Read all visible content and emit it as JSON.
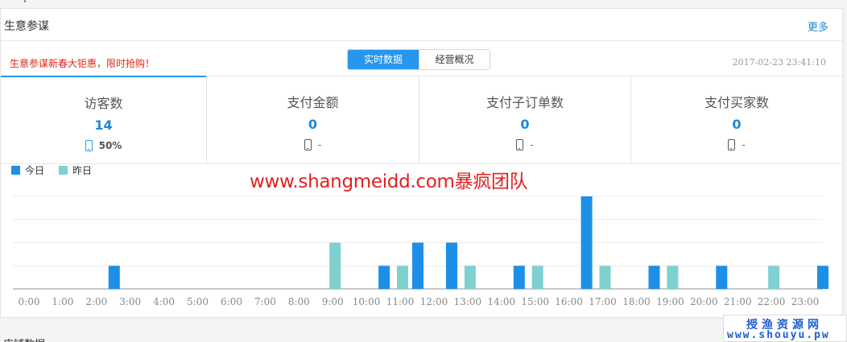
{
  "top_strip": {
    "text": "——/"
  },
  "panel": {
    "title": "生意参谋",
    "more": "更多"
  },
  "promo": "生意参谋新春大钜惠，限时抢购！",
  "tabs": [
    {
      "label": "实时数据",
      "active": true
    },
    {
      "label": "经营概况",
      "active": false
    }
  ],
  "timestamp": "2017-02-23 23:41:10",
  "metrics": [
    {
      "label": "访客数",
      "value": "14",
      "sub": "50%",
      "icon": "mobile-phone-icon",
      "active": true
    },
    {
      "label": "支付金额",
      "value": "0",
      "sub": "-",
      "icon": "mobile-phone-icon",
      "active": false
    },
    {
      "label": "支付子订单数",
      "value": "0",
      "sub": "-",
      "icon": "mobile-phone-icon",
      "active": false
    },
    {
      "label": "支付买家数",
      "value": "0",
      "sub": "-",
      "icon": "mobile-phone-icon",
      "active": false
    }
  ],
  "watermark": "www.shangmeidd.com暴疯团队",
  "bottom_strip": {
    "text": "店铺数据"
  },
  "badge": {
    "cn": "授渔资源网",
    "url": "www.shouyu.pw"
  },
  "colors": {
    "accent": "#2796ed",
    "today": "#1e8fe6",
    "yesterday": "#80d0d0",
    "promo": "#e0271a"
  },
  "chart_data": {
    "type": "bar",
    "legend": [
      "今日",
      "昨日"
    ],
    "categories": [
      "0:00",
      "1:00",
      "2:00",
      "3:00",
      "4:00",
      "5:00",
      "6:00",
      "7:00",
      "8:00",
      "9:00",
      "10:00",
      "11:00",
      "12:00",
      "13:00",
      "14:00",
      "15:00",
      "16:00",
      "17:00",
      "18:00",
      "19:00",
      "20:00",
      "21:00",
      "22:00",
      "23:00"
    ],
    "series": [
      {
        "name": "今日",
        "values": [
          0,
          0,
          1,
          0,
          0,
          0,
          0,
          0,
          0,
          0,
          1,
          2,
          2,
          0,
          1,
          0,
          4,
          0,
          1,
          0,
          1,
          0,
          0,
          1
        ]
      },
      {
        "name": "昨日",
        "values": [
          0,
          0,
          0,
          0,
          0,
          0,
          0,
          0,
          0,
          2,
          0,
          1,
          0,
          1,
          0,
          1,
          0,
          1,
          0,
          1,
          0,
          0,
          1,
          0
        ]
      }
    ],
    "ylim": [
      0,
      4
    ],
    "grid": true,
    "legend_position": "top-left"
  }
}
